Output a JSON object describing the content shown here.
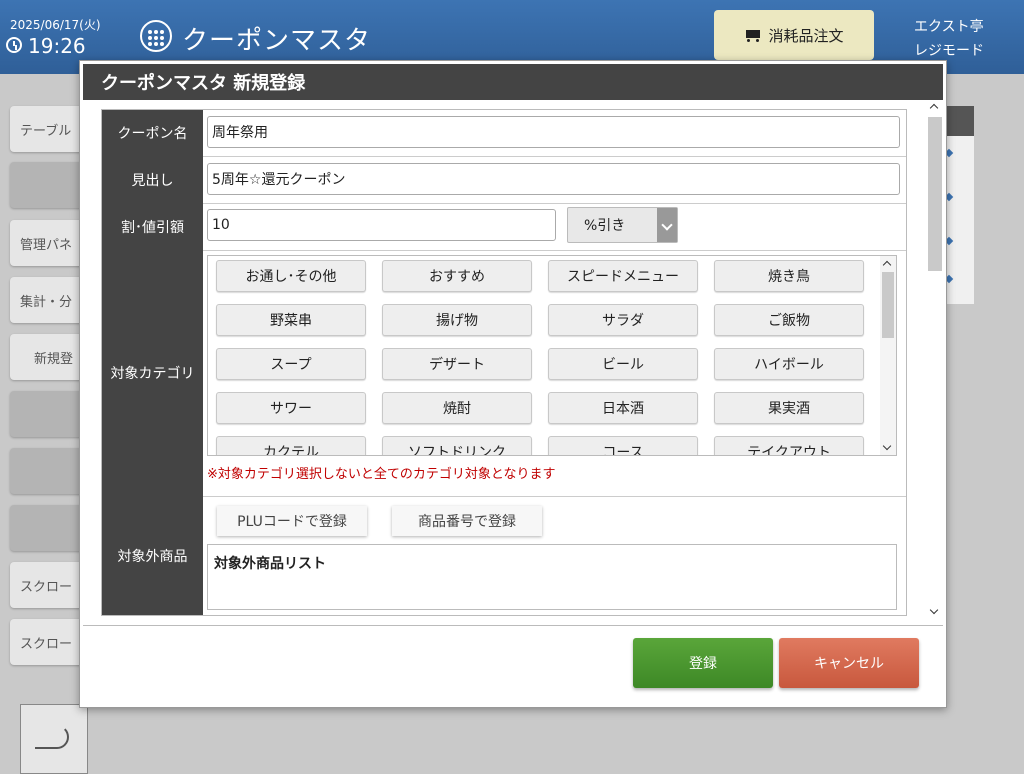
{
  "header": {
    "date": "2025/06/17(火)",
    "time": "19:26",
    "title": "クーポンマスタ",
    "order_button": "消耗品注文",
    "store": "エクスト亭",
    "mode": "レジモード"
  },
  "background_menu": [
    {
      "label": "テーブル"
    },
    {
      "label": ""
    },
    {
      "label": "管理パネ"
    },
    {
      "label": "集計・分"
    },
    {
      "label": "新規登"
    },
    {
      "label": ""
    },
    {
      "label": ""
    },
    {
      "label": ""
    },
    {
      "label": "スクロー"
    },
    {
      "label": "スクロー"
    }
  ],
  "modal": {
    "title": "クーポンマスタ 新規登録",
    "fields": {
      "name": {
        "label": "クーポン名",
        "value": "周年祭用"
      },
      "heading": {
        "label": "見出し",
        "value": "5周年☆還元クーポン"
      },
      "discount": {
        "label": "割･値引額",
        "value": "10",
        "type": "%引き"
      },
      "categories": {
        "label": "対象カテゴリ",
        "items": [
          "お通し･その他",
          "おすすめ",
          "スピードメニュー",
          "焼き鳥",
          "野菜串",
          "揚げ物",
          "サラダ",
          "ご飯物",
          "スープ",
          "デザート",
          "ビール",
          "ハイボール",
          "サワー",
          "焼酎",
          "日本酒",
          "果実酒",
          "カクテル",
          "ソフトドリンク",
          "コース",
          "テイクアウト"
        ],
        "note": "※対象カテゴリ選択しないと全てのカテゴリ対象となります"
      },
      "excluded": {
        "label": "対象外商品",
        "plu_button": "PLUコードで登録",
        "item_no_button": "商品番号で登録",
        "list_title": "対象外商品リスト"
      }
    },
    "submit": "登録",
    "cancel": "キャンセル"
  }
}
